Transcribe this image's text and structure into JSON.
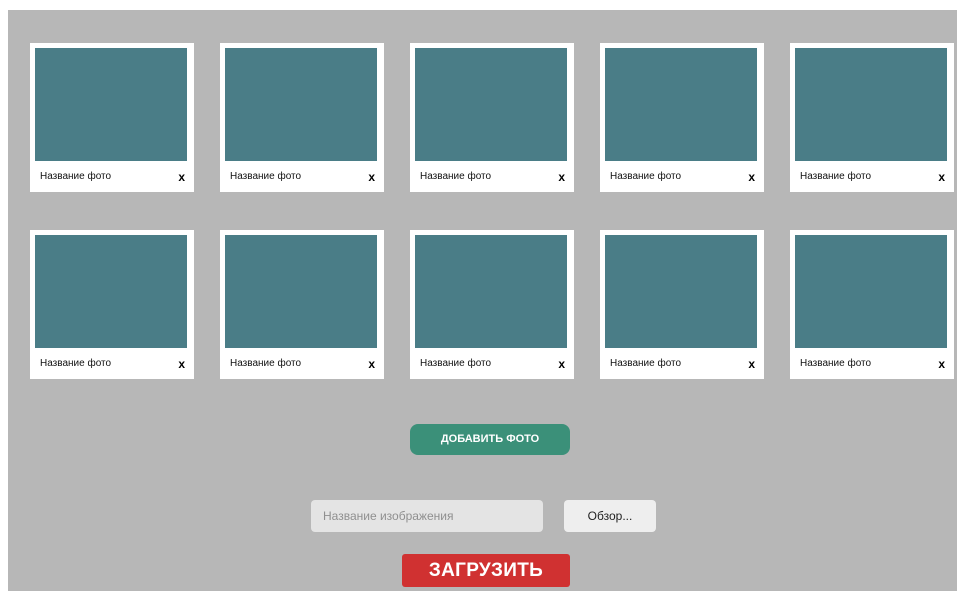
{
  "gallery": {
    "photos": [
      {
        "title": "Название фото",
        "remove_label": "x"
      },
      {
        "title": "Название фото",
        "remove_label": "x"
      },
      {
        "title": "Название фото",
        "remove_label": "x"
      },
      {
        "title": "Название фото",
        "remove_label": "x"
      },
      {
        "title": "Название фото",
        "remove_label": "x"
      },
      {
        "title": "Название фото",
        "remove_label": "x"
      },
      {
        "title": "Название фото",
        "remove_label": "x"
      },
      {
        "title": "Название фото",
        "remove_label": "x"
      },
      {
        "title": "Название фото",
        "remove_label": "x"
      },
      {
        "title": "Название фото",
        "remove_label": "x"
      }
    ]
  },
  "actions": {
    "add_photo_label": "ДОБАВИТЬ ФОТО",
    "browse_label": "Обзор...",
    "upload_label": "ЗАГРУЗИТЬ"
  },
  "upload_form": {
    "name_placeholder": "Название изображения",
    "name_value": ""
  },
  "colors": {
    "panel_background": "#b7b7b7",
    "thumbnail": "#4a7d87",
    "add_button": "#3b9079",
    "upload_button": "#d03131"
  }
}
